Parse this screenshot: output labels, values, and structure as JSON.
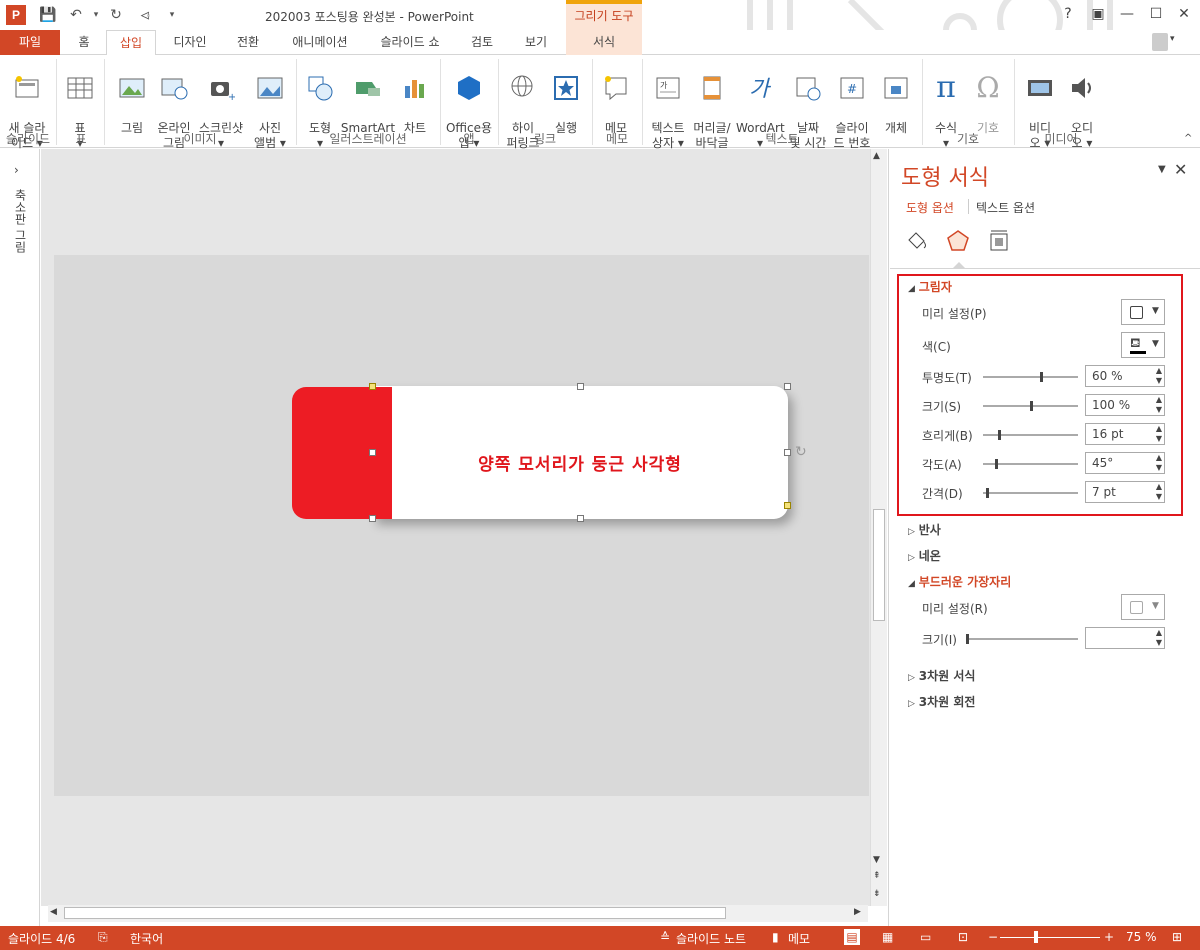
{
  "window": {
    "title": "202003 포스팅용 완성본 - PowerPoint",
    "context_tab_group": "그리기 도구"
  },
  "tabs": [
    "파일",
    "홈",
    "삽입",
    "디자인",
    "전환",
    "애니메이션",
    "슬라이드 쇼",
    "검토",
    "보기",
    "서식"
  ],
  "active_tab": "삽입",
  "ribbon": {
    "buttons": [
      {
        "label": "새 슬라\n이드 ▾",
        "icon": "new-slide-icon"
      },
      {
        "label": "표\n▾",
        "icon": "table-icon"
      },
      {
        "label": "그림",
        "icon": "picture-icon"
      },
      {
        "label": "온라인\n그림",
        "icon": "online-picture-icon"
      },
      {
        "label": "스크린샷\n▾",
        "icon": "screenshot-icon"
      },
      {
        "label": "사진\n앨범 ▾",
        "icon": "photo-album-icon"
      },
      {
        "label": "도형\n▾",
        "icon": "shapes-icon"
      },
      {
        "label": "SmartArt",
        "icon": "smartart-icon"
      },
      {
        "label": "차트",
        "icon": "chart-icon"
      },
      {
        "label": "Office용\n앱 ▾",
        "icon": "office-apps-icon"
      },
      {
        "label": "하이\n퍼링크",
        "icon": "hyperlink-icon"
      },
      {
        "label": "실행",
        "icon": "action-icon"
      },
      {
        "label": "메모",
        "icon": "comment-icon"
      },
      {
        "label": "텍스트\n상자 ▾",
        "icon": "textbox-icon"
      },
      {
        "label": "머리글/\n바닥글",
        "icon": "header-footer-icon"
      },
      {
        "label": "WordArt\n▾",
        "icon": "wordart-icon"
      },
      {
        "label": "날짜\n및 시간",
        "icon": "date-time-icon"
      },
      {
        "label": "슬라이\n드 번호",
        "icon": "slide-number-icon"
      },
      {
        "label": "개체",
        "icon": "object-icon"
      },
      {
        "label": "수식\n▾",
        "icon": "equation-icon"
      },
      {
        "label": "기호",
        "icon": "symbol-icon"
      },
      {
        "label": "비디\n오 ▾",
        "icon": "video-icon"
      },
      {
        "label": "오디\n오 ▾",
        "icon": "audio-icon"
      }
    ],
    "groups": [
      "슬라이드",
      "표",
      "이미지",
      "일러스트레이션",
      "앱",
      "링크",
      "메모",
      "텍스트",
      "기호",
      "미디어"
    ]
  },
  "left_pane": {
    "label": "축소판 그림"
  },
  "slide": {
    "shape_text": "양쪽 모서리가 둥근 사각형",
    "colors": {
      "red": "#ed1c24",
      "text": "#e0161c"
    }
  },
  "format_pane": {
    "title": "도형 서식",
    "options": [
      "도형 옵션",
      "텍스트 옵션"
    ],
    "shadow": {
      "heading": "그림자",
      "preset_label": "미리 설정(P)",
      "color_label": "색(C)",
      "rows": [
        {
          "label": "투명도(T)",
          "value": "60 %",
          "level": 0.6
        },
        {
          "label": "크기(S)",
          "value": "100 %",
          "level": 0.5
        },
        {
          "label": "흐리게(B)",
          "value": "16 pt",
          "level": 0.16
        },
        {
          "label": "각도(A)",
          "value": "45°",
          "level": 0.125
        },
        {
          "label": "간격(D)",
          "value": "7 pt",
          "level": 0.04
        }
      ]
    },
    "reflection": "반사",
    "glow": "네온",
    "soft_edges": {
      "heading": "부드러운 가장자리",
      "preset_label": "미리 설정(R)",
      "size_label": "크기(I)",
      "size_value": ""
    },
    "format_3d": "3차원 서식",
    "rotation_3d": "3차원 회전"
  },
  "status": {
    "slide": "슬라이드 4/6",
    "language": "한국어",
    "notes": "슬라이드 노트",
    "comments": "메모",
    "zoom": "75 %"
  }
}
